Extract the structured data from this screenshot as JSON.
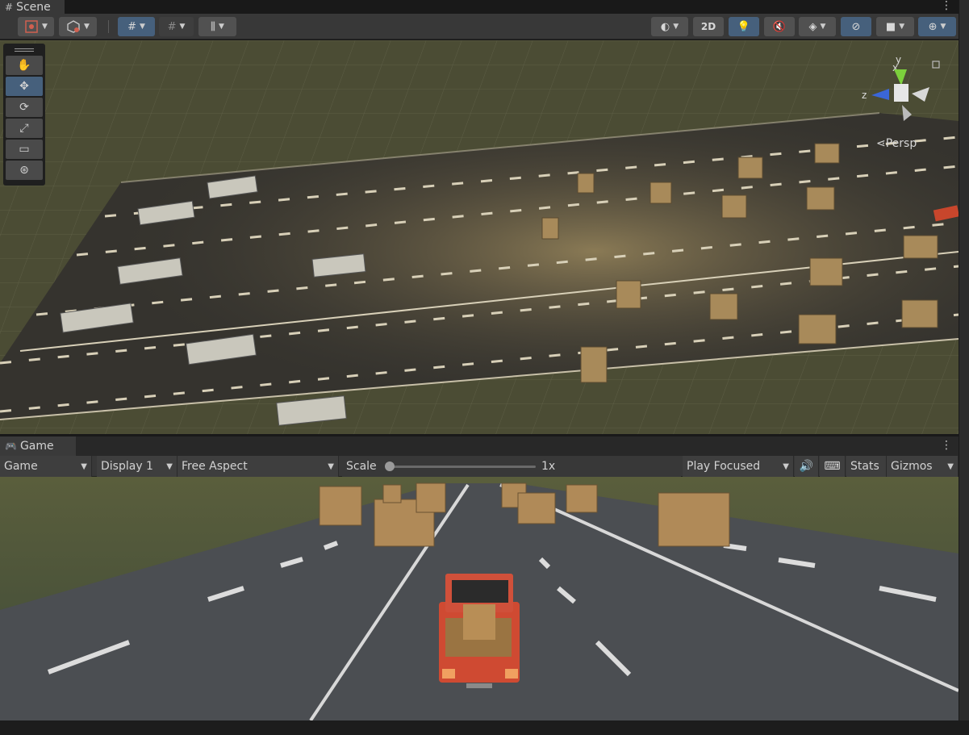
{
  "scene_tab": {
    "label": "Scene",
    "icon": "grid-icon"
  },
  "scene_toolbar": {
    "left_tools": [
      "gizmo-handle-icon",
      "pivot-cube-icon",
      "grid-snap-icon",
      "increment-snap-icon",
      "ruler-icon"
    ],
    "mode_2d": "2D",
    "right_tools": [
      "draw-mode-icon",
      "lighting-icon",
      "audio-mute-icon",
      "effects-icon",
      "hidden-visibility-icon",
      "camera-icon",
      "gizmos-icon"
    ]
  },
  "transform_tools": [
    "hand-icon",
    "move-icon",
    "rotate-icon",
    "scale-icon",
    "rect-icon",
    "transform-icon"
  ],
  "scene_gizmo": {
    "x_label": "x",
    "y_label": "y",
    "z_label": "z",
    "persp_label": "Persp"
  },
  "game_tab": {
    "label": "Game",
    "icon": "gamepad-icon"
  },
  "game_toolbar": {
    "view_select": "Game",
    "display_select": "Display 1",
    "aspect_select": "Free Aspect",
    "scale_label": "Scale",
    "scale_value": "1x",
    "scale_fraction": 0.0,
    "play_mode_select": "Play Focused",
    "stats_label": "Stats",
    "gizmos_label": "Gizmos"
  },
  "colors": {
    "panel": "#383838",
    "accent": "#46607c",
    "truck": "#d0462e",
    "crate": "#b48a55"
  }
}
